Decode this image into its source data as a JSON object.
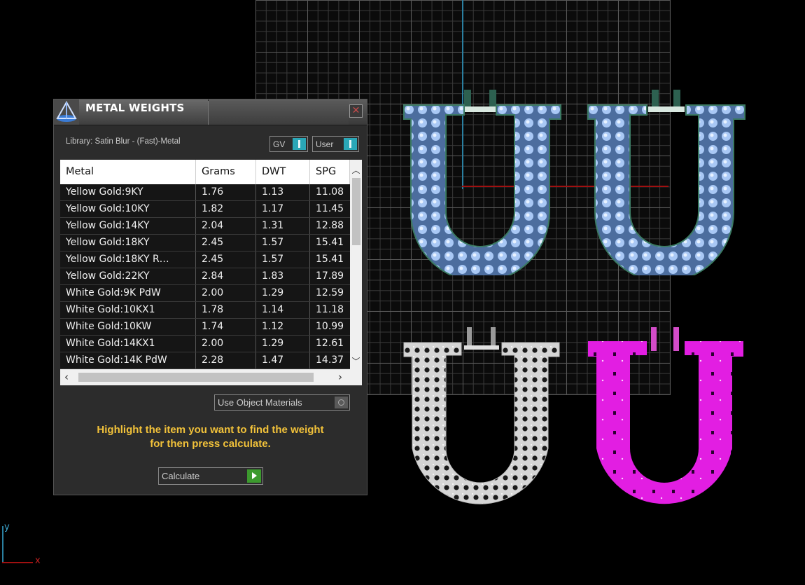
{
  "panel": {
    "title": "METAL WEIGHTS",
    "close_icon": "close-icon",
    "library_label": "Library: Satin Blur - (Fast)-Metal",
    "gv_label": "GV",
    "user_label": "User"
  },
  "table": {
    "columns": [
      "Metal",
      "Grams",
      "DWT",
      "SPG"
    ],
    "rows": [
      [
        "Yellow Gold:9KY",
        "1.76",
        "1.13",
        "11.08"
      ],
      [
        "Yellow Gold:10KY",
        "1.82",
        "1.17",
        "11.45"
      ],
      [
        "Yellow Gold:14KY",
        "2.04",
        "1.31",
        "12.88"
      ],
      [
        "Yellow Gold:18KY",
        "2.45",
        "1.57",
        "15.41"
      ],
      [
        "Yellow Gold:18KY R…",
        "2.45",
        "1.57",
        "15.41"
      ],
      [
        "Yellow Gold:22KY",
        "2.84",
        "1.83",
        "17.89"
      ],
      [
        "White Gold:9K PdW",
        "2.00",
        "1.29",
        "12.59"
      ],
      [
        "White Gold:10KX1",
        "1.78",
        "1.14",
        "11.18"
      ],
      [
        "White Gold:10KW",
        "1.74",
        "1.12",
        "10.99"
      ],
      [
        "White Gold:14KX1",
        "2.00",
        "1.29",
        "12.61"
      ],
      [
        "White Gold:14K PdW",
        "2.28",
        "1.47",
        "14.37"
      ]
    ]
  },
  "options": {
    "use_object_materials": "Use Object Materials"
  },
  "hint": {
    "line1": "Highlight the item you want to find the weight",
    "line2": "for then press calculate."
  },
  "calculate_label": "Calculate",
  "axis": {
    "y_label": "y",
    "x_label": "x"
  },
  "colors": {
    "accent": "#2aa7b7",
    "hint": "#f2c23a",
    "go_button": "#3c9a2e",
    "model_blue": "#8fb8ef",
    "model_magenta": "#e21ee2",
    "model_silver": "#c9c9c9"
  }
}
